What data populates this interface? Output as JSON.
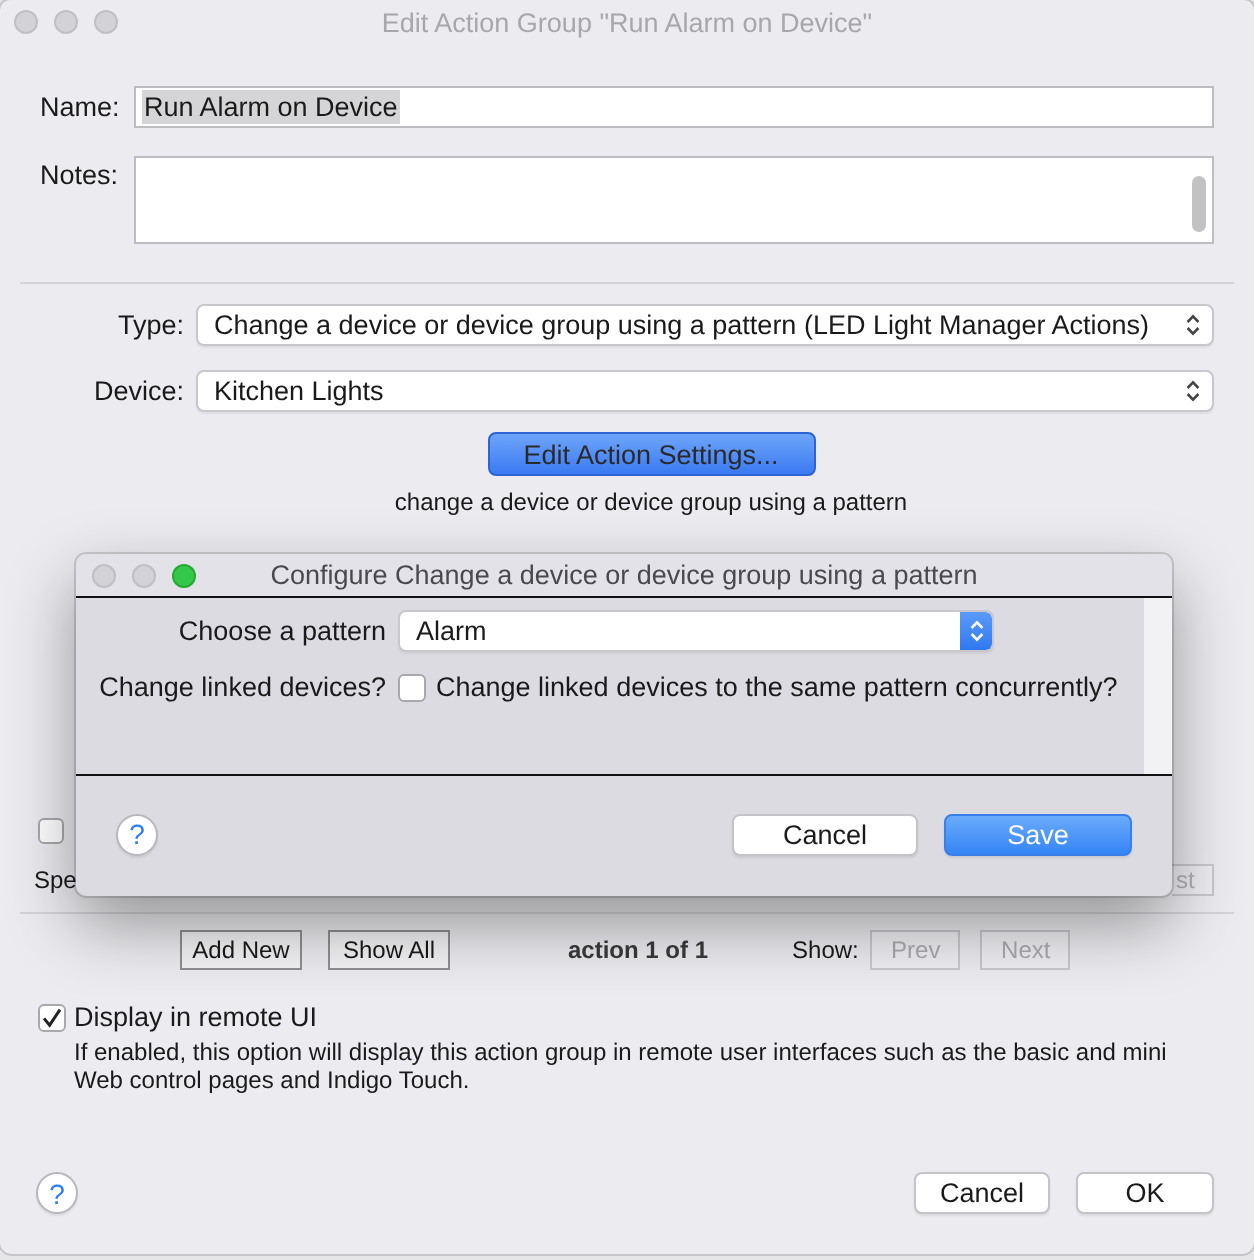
{
  "window": {
    "title": "Edit Action Group \"Run Alarm on Device\"",
    "window_buttons": [
      {
        "enabled": false
      },
      {
        "enabled": false
      },
      {
        "enabled": false
      }
    ]
  },
  "name_field": {
    "label": "Name:",
    "value": "Run Alarm on Device",
    "text_selected": true
  },
  "notes_field": {
    "label": "Notes:"
  },
  "popups": [
    {
      "label": "Type:",
      "value": "Change a device or device group using a pattern (LED Light Manager Actions)"
    },
    {
      "label": "Device:",
      "value": "Kitchen Lights"
    }
  ],
  "edit_settings_button": {
    "label": "Edit Action Settings...",
    "default": true
  },
  "action_description": "change a device or device group using a pattern",
  "covered_row": {
    "checkbox": {
      "checked": false
    },
    "label": "Spe",
    "button": {
      "label": "st",
      "disabled": true
    }
  },
  "action_nav": {
    "buttons": [
      {
        "label": "Add New",
        "disabled": false
      },
      {
        "label": "Show All",
        "disabled": false
      }
    ],
    "counter": "action 1 of 1",
    "show_label": "Show:",
    "nav_buttons": [
      {
        "label": "Prev",
        "disabled": true
      },
      {
        "label": "Next",
        "disabled": true
      }
    ]
  },
  "remote_ui": {
    "label": "Display in remote UI",
    "checked": true,
    "description": "If enabled, this option will display this action group in remote user interfaces such as the basic and mini Web control pages and Indigo Touch."
  },
  "footer": {
    "help": "?",
    "buttons": [
      {
        "label": "Cancel",
        "default": false
      },
      {
        "label": "OK",
        "default": false
      }
    ]
  },
  "dialog": {
    "title": "Configure Change a device or device group using a pattern",
    "window_buttons": [
      {
        "enabled": false
      },
      {
        "enabled": false
      },
      {
        "enabled": true
      }
    ],
    "fields": [
      {
        "kind": "popup",
        "label": "Choose a pattern",
        "value": "Alarm"
      },
      {
        "kind": "checkbox",
        "label": "Change linked devices?",
        "text": "Change linked devices to the same pattern concurrently?",
        "checked": false
      }
    ],
    "help": "?",
    "buttons": [
      {
        "label": "Cancel",
        "default": false
      },
      {
        "label": "Save",
        "default": true
      }
    ]
  }
}
